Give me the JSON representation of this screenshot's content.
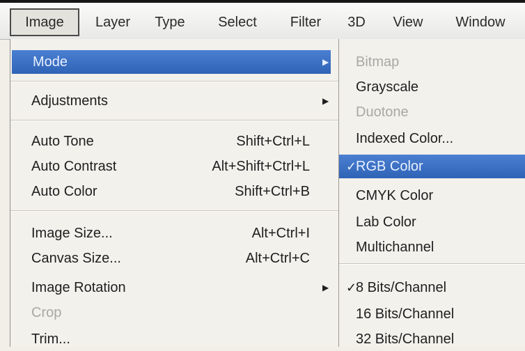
{
  "menubar": {
    "items": [
      "Image",
      "Layer",
      "Type",
      "Select",
      "Filter",
      "3D",
      "View",
      "Window"
    ]
  },
  "image_menu": {
    "items": [
      {
        "label": "Mode",
        "shortcut": "",
        "submenu": true,
        "highlighted": true
      },
      {
        "label": "Adjustments",
        "shortcut": "",
        "submenu": true
      },
      {
        "label": "Auto Tone",
        "shortcut": "Shift+Ctrl+L"
      },
      {
        "label": "Auto Contrast",
        "shortcut": "Alt+Shift+Ctrl+L"
      },
      {
        "label": "Auto Color",
        "shortcut": "Shift+Ctrl+B"
      },
      {
        "label": "Image Size...",
        "shortcut": "Alt+Ctrl+I"
      },
      {
        "label": "Canvas Size...",
        "shortcut": "Alt+Ctrl+C"
      },
      {
        "label": "Image Rotation",
        "shortcut": "",
        "submenu": true
      },
      {
        "label": "Crop",
        "shortcut": "",
        "disabled": true
      },
      {
        "label": "Trim...",
        "shortcut": ""
      }
    ]
  },
  "mode_submenu": {
    "items": [
      {
        "label": "Bitmap",
        "disabled": true
      },
      {
        "label": "Grayscale"
      },
      {
        "label": "Duotone",
        "disabled": true
      },
      {
        "label": "Indexed Color..."
      },
      {
        "label": "RGB Color",
        "checked": true,
        "highlighted": true
      },
      {
        "label": "CMYK Color"
      },
      {
        "label": "Lab Color"
      },
      {
        "label": "Multichannel"
      },
      {
        "label": "8 Bits/Channel",
        "checked": true
      },
      {
        "label": "16 Bits/Channel"
      },
      {
        "label": "32 Bits/Channel"
      }
    ],
    "check_glyph": "✓"
  },
  "glyphs": {
    "submenu_arrow": "▶"
  },
  "colors": {
    "highlight": "#3a6fc4",
    "disabled_text": "#a8a8a4"
  }
}
